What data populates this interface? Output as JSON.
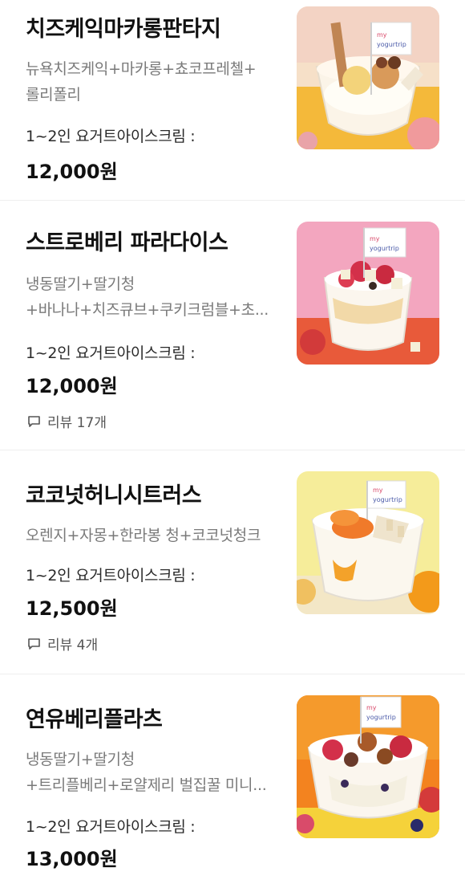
{
  "menu": [
    {
      "name": "치즈케익마카롱판타지",
      "desc_lines": [
        "뉴욕치즈케익+마카롱+쵸코프레첼+",
        "롤리폴리"
      ],
      "option": "1~2인 요거트아이스크림 :",
      "price": "12,000원",
      "review": "",
      "flag_text": "my yogurtrip"
    },
    {
      "name": "스트로베리 파라다이스",
      "desc_lines": [
        "냉동딸기+딸기청",
        "+바나나+치즈큐브+쿠키크럼블+초..."
      ],
      "option": "1~2인 요거트아이스크림 :",
      "price": "12,000원",
      "review": "리뷰 17개",
      "flag_text": "my yogurtrip"
    },
    {
      "name": "코코넛허니시트러스",
      "desc_lines": [
        "오렌지+자몽+한라봉 청+코코넛청크"
      ],
      "option": "1~2인 요거트아이스크림 :",
      "price": "12,500원",
      "review": "리뷰 4개",
      "flag_text": "my yogurtrip"
    },
    {
      "name": "연유베리플라츠",
      "desc_lines": [
        "냉동딸기+딸기청",
        "+트리플베리+로얄제리 벌집꿀 미니..."
      ],
      "option": "1~2인 요거트아이스크림 :",
      "price": "13,000원",
      "review": "",
      "flag_text": "my yogurtrip"
    }
  ],
  "icons": {
    "review": "speech-bubble-icon"
  },
  "colors": {
    "title": "#111111",
    "desc": "#7a7a7a",
    "divider": "#efefef"
  }
}
